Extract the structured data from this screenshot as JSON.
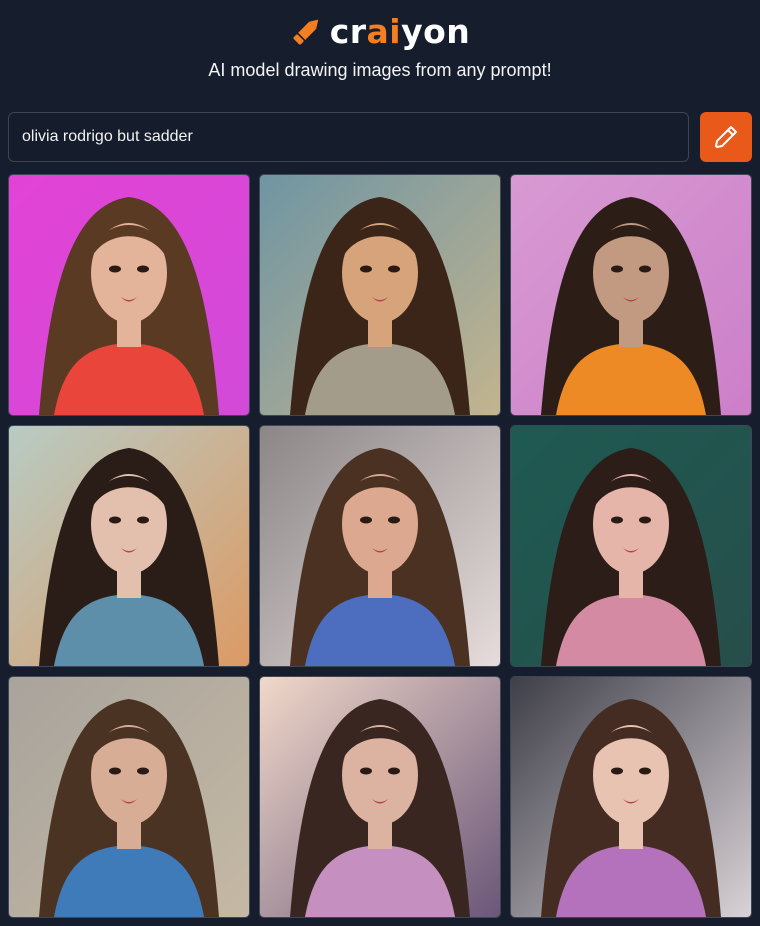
{
  "header": {
    "logo_prefix": "cr",
    "logo_accent": "ai",
    "logo_suffix": "yon",
    "tagline": "AI model drawing images from any prompt!",
    "brand_color": "#f47f20"
  },
  "search": {
    "value": "olivia rodrigo but sadder",
    "button_icon": "pencil-icon",
    "button_color": "#e8591a"
  },
  "results": {
    "images": [
      {
        "bg": "#e243d6",
        "bg2": "#d24ad8",
        "top": "#e9453a",
        "hair": "#5b3a24",
        "skin": "#e3b39a"
      },
      {
        "bg": "#6f95a3",
        "bg2": "#c3b48f",
        "top": "#a39c8a",
        "hair": "#3b2518",
        "skin": "#d6a37a"
      },
      {
        "bg": "#d89ad3",
        "bg2": "#cc7fc8",
        "top": "#ee8a26",
        "hair": "#2c1e17",
        "skin": "#c29a82"
      },
      {
        "bg": "#b8cbc4",
        "bg2": "#dc9a64",
        "top": "#5d8fab",
        "hair": "#2a1d18",
        "skin": "#e2c0ad"
      },
      {
        "bg": "#8c8687",
        "bg2": "#e6dddb",
        "top": "#4d6dbf",
        "hair": "#4a3122",
        "skin": "#dca88f"
      },
      {
        "bg": "#1e5a52",
        "bg2": "#274e4a",
        "top": "#d58aa4",
        "hair": "#2d1d18",
        "skin": "#e4b5a8"
      },
      {
        "bg": "#a8a39c",
        "bg2": "#c5b9a4",
        "top": "#3f7bb8",
        "hair": "#4a3323",
        "skin": "#d8ad95"
      },
      {
        "bg": "#f0d8c9",
        "bg2": "#6a5678",
        "top": "#c590c0",
        "hair": "#3a2620",
        "skin": "#dcb2a0"
      },
      {
        "bg": "#3f3f49",
        "bg2": "#d9d2d6",
        "top": "#b472bc",
        "hair": "#452c22",
        "skin": "#e9c3b1"
      }
    ]
  }
}
